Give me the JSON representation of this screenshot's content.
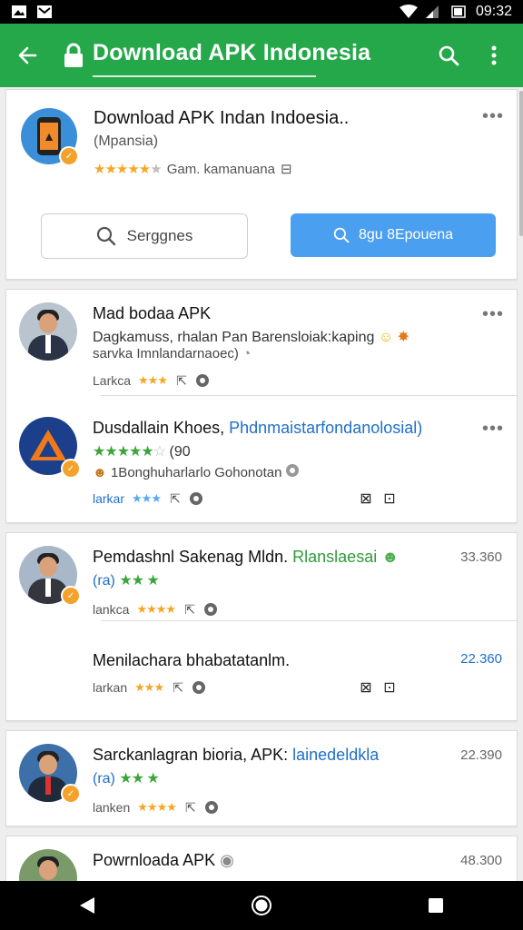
{
  "status": {
    "time": "09:32"
  },
  "appbar": {
    "title": "Download APK Indonesia"
  },
  "hero": {
    "name": "Download APK Indan Indoesia..",
    "subtitle": "(Mpansia)",
    "meta": "Gam. kamanuana",
    "search_button": "Serggnes",
    "primary_button": "8gu 8Epouena"
  },
  "items": [
    {
      "title": "Mad bodaa APK",
      "line2": "Dagkamuss, rhalan Pan Barensloiak:kaping",
      "line3": "sarvka Imnlandarnaoec)",
      "foot_label": "Larkca"
    },
    {
      "title_main": "Dusdallain Khoes,",
      "title_accent": "Phdnmaistarfondanolosial)",
      "rating_text": "(90",
      "line3": "1Bonghuharlarlo Gohonotan",
      "foot_label": "larkar"
    },
    {
      "title_main": "Pemdashnl Sakenag Mldn.",
      "title_accent": "Rlanslaesai",
      "rating_text": "(ra)",
      "foot_label": "lankca",
      "count": "33.360"
    },
    {
      "title": "Menilachara bhabatatanlm.",
      "foot_label": "larkan",
      "count": "22.360"
    },
    {
      "title_main": "Sarckanlagran bioria, APK:",
      "title_accent": "lainedeldkla",
      "rating_text": "(ra)",
      "foot_label": "lanken",
      "count": "22.390"
    },
    {
      "title": "Powrnloada APK",
      "count": "48.300"
    }
  ]
}
